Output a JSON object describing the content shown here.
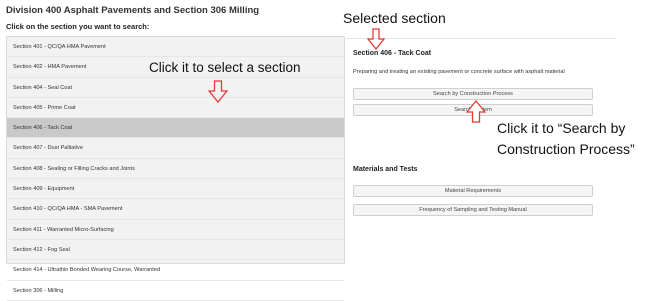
{
  "page": {
    "title": "Division 400 Asphalt Pavements and Section 306 Milling",
    "instruction": "Click on the section you want to search:"
  },
  "sections": [
    {
      "label": "Section 401 - QC/QA HMA Pavement",
      "selected": false
    },
    {
      "label": "Section 402 - HMA Pavement",
      "selected": false
    },
    {
      "label": "Section 404 - Seal Coat",
      "selected": false
    },
    {
      "label": "Section 405 - Prime Coat",
      "selected": false
    },
    {
      "label": "Section 406 - Tack Coat",
      "selected": true
    },
    {
      "label": "Section 407 - Dust Palliative",
      "selected": false
    },
    {
      "label": "Section 408 - Sealing or Filling Cracks and Joints",
      "selected": false
    },
    {
      "label": "Section 409 - Equipment",
      "selected": false
    },
    {
      "label": "Section 410 - QC/QA HMA - SMA Pavement",
      "selected": false
    },
    {
      "label": "Section 411 - Warranted Micro-Surfacing",
      "selected": false
    },
    {
      "label": "Section 412 - Fog Seal",
      "selected": false
    },
    {
      "label": "Section 414 - Ultrathin Bonded Wearing Course, Warranted",
      "selected": false
    },
    {
      "label": "Section 306 - Milling",
      "selected": false
    }
  ],
  "detail": {
    "title": "Section 406 - Tack Coat",
    "description": "Preparing and treating an existing pavement or concrete surface with asphalt material",
    "buttons": {
      "search_by_process": "Search by Construction Process",
      "search_by_item": "Search by Item"
    }
  },
  "materials": {
    "heading": "Materials and Tests",
    "buttons": {
      "requirements": "Material Requirements",
      "frequency": "Frequency of Sampling and Testing Manual"
    }
  },
  "annotations": {
    "selected_section": "Selected section",
    "select_hint": "Click it to select a section",
    "search_hint": "Click it to “Search by Construction Process”"
  },
  "colors": {
    "list_background": "#f2f2f2",
    "selected_row": "#c9c9c9",
    "arrow": "#e53935"
  }
}
